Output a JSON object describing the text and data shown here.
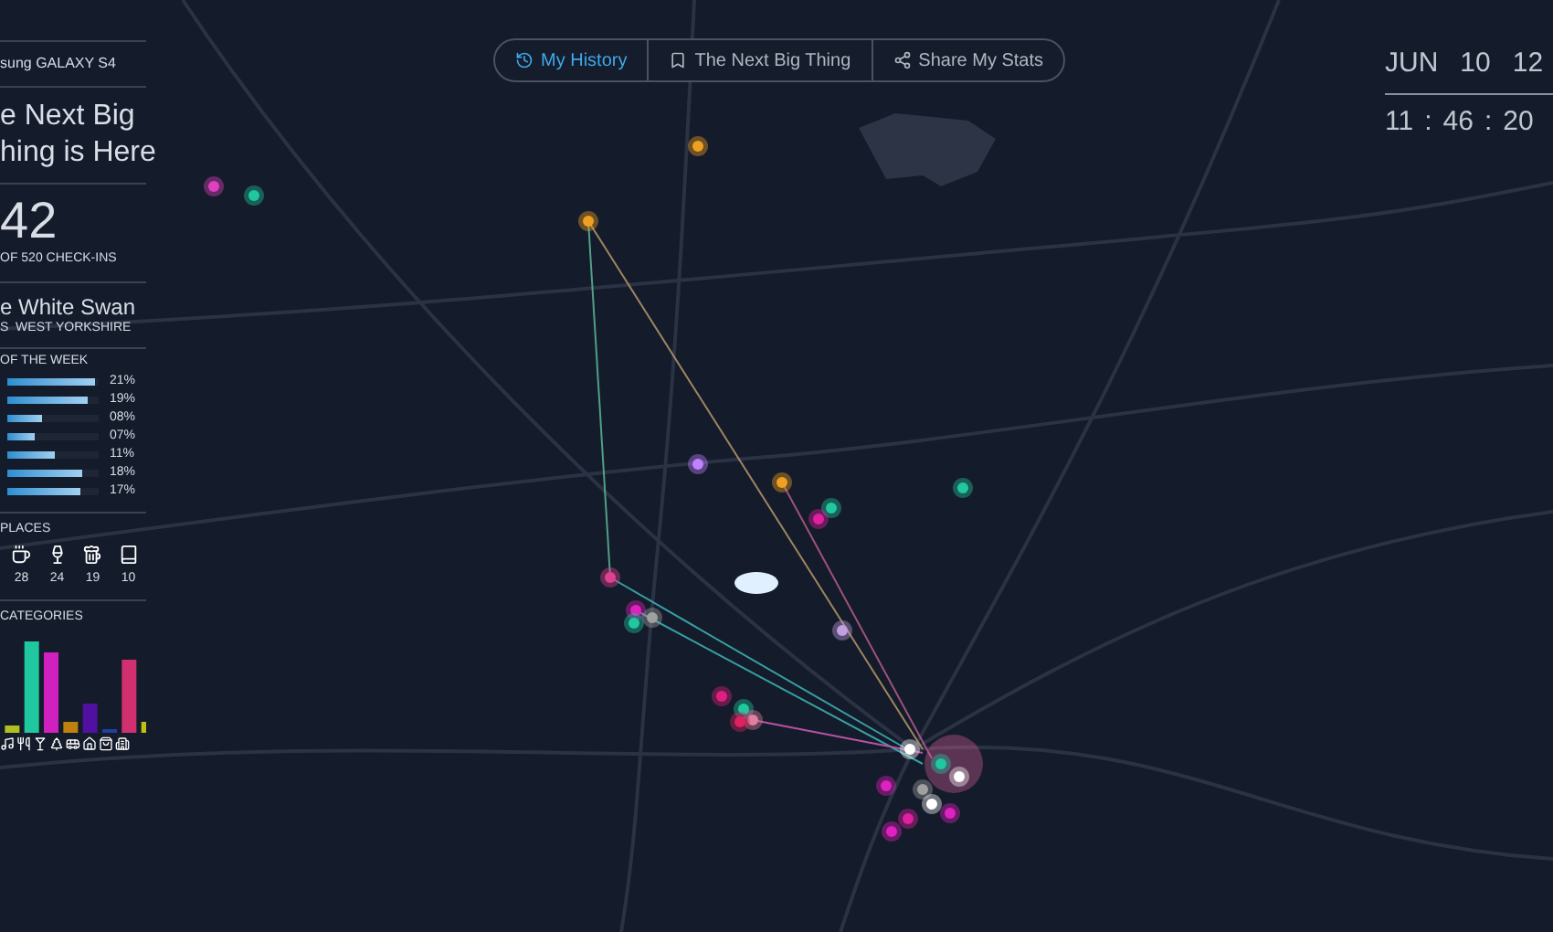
{
  "sidebar": {
    "logo": "sung GALAXY S4",
    "headline": [
      "e Next Big",
      "hing is Here"
    ],
    "checkins": {
      "count": "42",
      "caption": "OF 520 CHECK-INS"
    },
    "venue": {
      "name": "e White Swan",
      "location": "S  WEST YORKSHIRE"
    },
    "week": {
      "title": "OF THE WEEK",
      "days": [
        {
          "level": 0.96,
          "reading": "21%"
        },
        {
          "level": 0.88,
          "reading": "19%"
        },
        {
          "level": 0.38,
          "reading": "08%"
        },
        {
          "level": 0.3,
          "reading": "07%"
        },
        {
          "level": 0.52,
          "reading": "11%"
        },
        {
          "level": 0.82,
          "reading": "18%"
        },
        {
          "level": 0.8,
          "reading": "17%"
        }
      ]
    },
    "places": {
      "title": "PLACES",
      "items": [
        {
          "kind": "cafe",
          "count": "28"
        },
        {
          "kind": "bar",
          "count": "24"
        },
        {
          "kind": "pub",
          "count": "19"
        },
        {
          "kind": "library",
          "count": "10"
        }
      ]
    },
    "categories": {
      "title": "CATEGORIES"
    }
  },
  "tabs": [
    {
      "label": "My History",
      "selected": true
    },
    {
      "label": "The Next Big Thing",
      "selected": false
    },
    {
      "label": "Share My Stats",
      "selected": false
    }
  ],
  "clock": {
    "month": "JUN",
    "day": "10",
    "year": "12",
    "hours": "11",
    "sep1": ":",
    "minutes": "46",
    "sep2": ":",
    "seconds": "20"
  }
}
